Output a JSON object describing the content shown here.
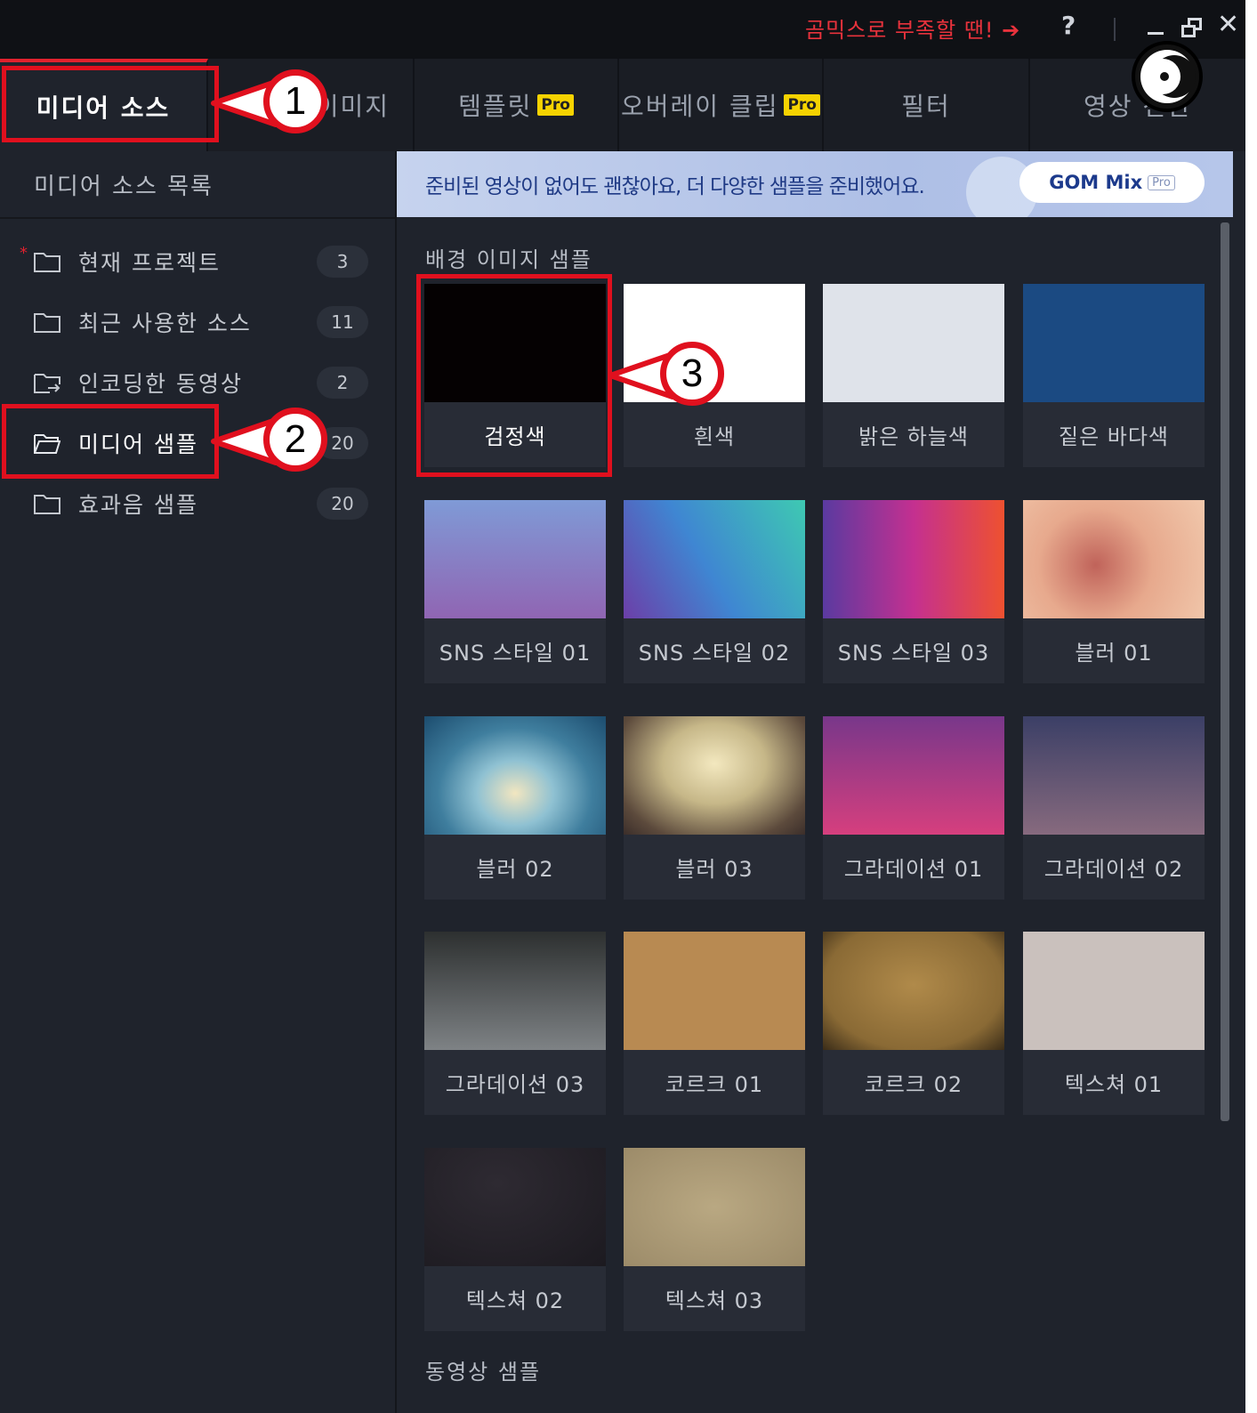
{
  "titlebar": {
    "promo_text": "곰믹스로 부족할 땐! ➔",
    "help": "?",
    "close": "✕"
  },
  "tabs": [
    {
      "label": "미디어 소스",
      "pro": ""
    },
    {
      "label": "텍스트/이미지",
      "pro": ""
    },
    {
      "label": "템플릿",
      "pro": "Pro"
    },
    {
      "label": "오버레이 클립",
      "pro": "Pro"
    },
    {
      "label": "필터",
      "pro": ""
    },
    {
      "label": "영상 전환",
      "pro": ""
    }
  ],
  "sidebar": {
    "header": "미디어 소스 목록",
    "items": [
      {
        "label": "현재 프로젝트",
        "count": "3"
      },
      {
        "label": "최근 사용한 소스",
        "count": "11"
      },
      {
        "label": "인코딩한 동영상",
        "count": "2"
      },
      {
        "label": "미디어 샘플",
        "count": "20"
      },
      {
        "label": "효과음 샘플",
        "count": "20"
      }
    ]
  },
  "banner": {
    "text": "준비된 영상이 없어도 괜찮아요, 더 다양한 샘플을 준비했어요.",
    "button": "GOM Mix",
    "button_badge": "Pro"
  },
  "sections": {
    "images": "배경 이미지 샘플",
    "videos": "동영상 샘플"
  },
  "samples": [
    {
      "label": "검정색"
    },
    {
      "label": "흰색"
    },
    {
      "label": "밝은 하늘색"
    },
    {
      "label": "짙은 바다색"
    },
    {
      "label": "SNS 스타일 01"
    },
    {
      "label": "SNS 스타일 02"
    },
    {
      "label": "SNS 스타일 03"
    },
    {
      "label": "블러 01"
    },
    {
      "label": "블러 02"
    },
    {
      "label": "블러 03"
    },
    {
      "label": "그라데이션 01"
    },
    {
      "label": "그라데이션 02"
    },
    {
      "label": "그라데이션 03"
    },
    {
      "label": "코르크 01"
    },
    {
      "label": "코르크 02"
    },
    {
      "label": "텍스쳐 01"
    },
    {
      "label": "텍스쳐 02"
    },
    {
      "label": "텍스쳐 03"
    }
  ],
  "callouts": [
    "1",
    "2",
    "3"
  ],
  "colors": {
    "accent": "#e0212e",
    "annotation": "#e0101e",
    "pro_badge": "#f6d300"
  }
}
